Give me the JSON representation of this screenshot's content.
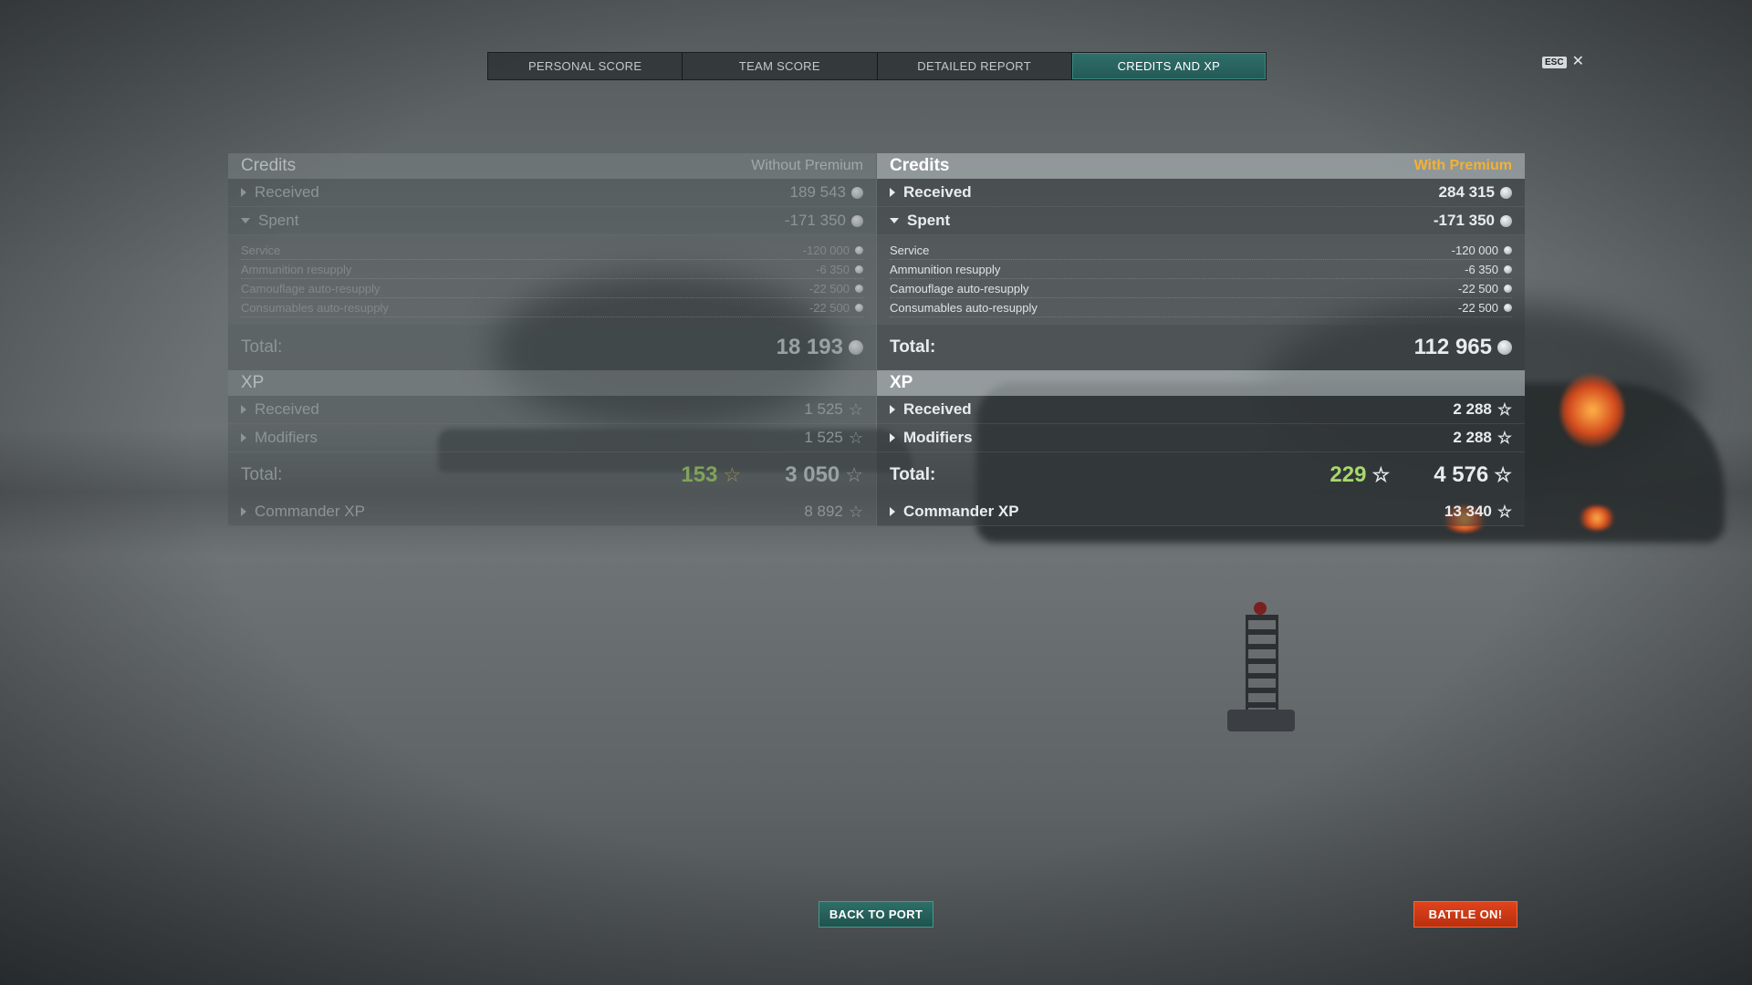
{
  "tabs": [
    {
      "label": "PERSONAL SCORE"
    },
    {
      "label": "TEAM SCORE"
    },
    {
      "label": "DETAILED REPORT"
    },
    {
      "label": "CREDITS AND XP"
    }
  ],
  "esc": {
    "key": "ESC",
    "close": "✕"
  },
  "left": {
    "credits_title": "Credits",
    "credits_note": "Without Premium",
    "received_label": "Received",
    "received_value": "189 543",
    "spent_label": "Spent",
    "spent_value": "-171 350",
    "spent_items": [
      {
        "label": "Service",
        "value": "-120 000"
      },
      {
        "label": "Ammunition resupply",
        "value": "-6 350"
      },
      {
        "label": "Camouflage auto-resupply",
        "value": "-22 500"
      },
      {
        "label": "Consumables auto-resupply",
        "value": "-22 500"
      }
    ],
    "credits_total_label": "Total:",
    "credits_total_value": "18 193",
    "xp_title": "XP",
    "xp_received_label": "Received",
    "xp_received_value": "1 525",
    "xp_modifiers_label": "Modifiers",
    "xp_modifiers_value": "1 525",
    "xp_total_label": "Total:",
    "xp_total_free": "153",
    "xp_total_value": "3 050",
    "commander_label": "Commander XP",
    "commander_value": "8 892"
  },
  "right": {
    "credits_title": "Credits",
    "credits_note": "With Premium",
    "received_label": "Received",
    "received_value": "284 315",
    "spent_label": "Spent",
    "spent_value": "-171 350",
    "spent_items": [
      {
        "label": "Service",
        "value": "-120 000"
      },
      {
        "label": "Ammunition resupply",
        "value": "-6 350"
      },
      {
        "label": "Camouflage auto-resupply",
        "value": "-22 500"
      },
      {
        "label": "Consumables auto-resupply",
        "value": "-22 500"
      }
    ],
    "credits_total_label": "Total:",
    "credits_total_value": "112 965",
    "xp_title": "XP",
    "xp_received_label": "Received",
    "xp_received_value": "2 288",
    "xp_modifiers_label": "Modifiers",
    "xp_modifiers_value": "2 288",
    "xp_total_label": "Total:",
    "xp_total_free": "229",
    "xp_total_value": "4 576",
    "commander_label": "Commander XP",
    "commander_value": "13 340"
  },
  "buttons": {
    "back_to_port": "BACK TO PORT",
    "battle_on": "BATTLE ON!"
  },
  "icons": {
    "credit": "credit-coin-icon",
    "xp": "star-icon",
    "free_xp": "gold-star-icon"
  },
  "colors": {
    "premium_accent": "#f2b233",
    "active_tab": "#2f6f6a",
    "battle_button": "#e0431c",
    "xp_green": "#a7d86c"
  }
}
